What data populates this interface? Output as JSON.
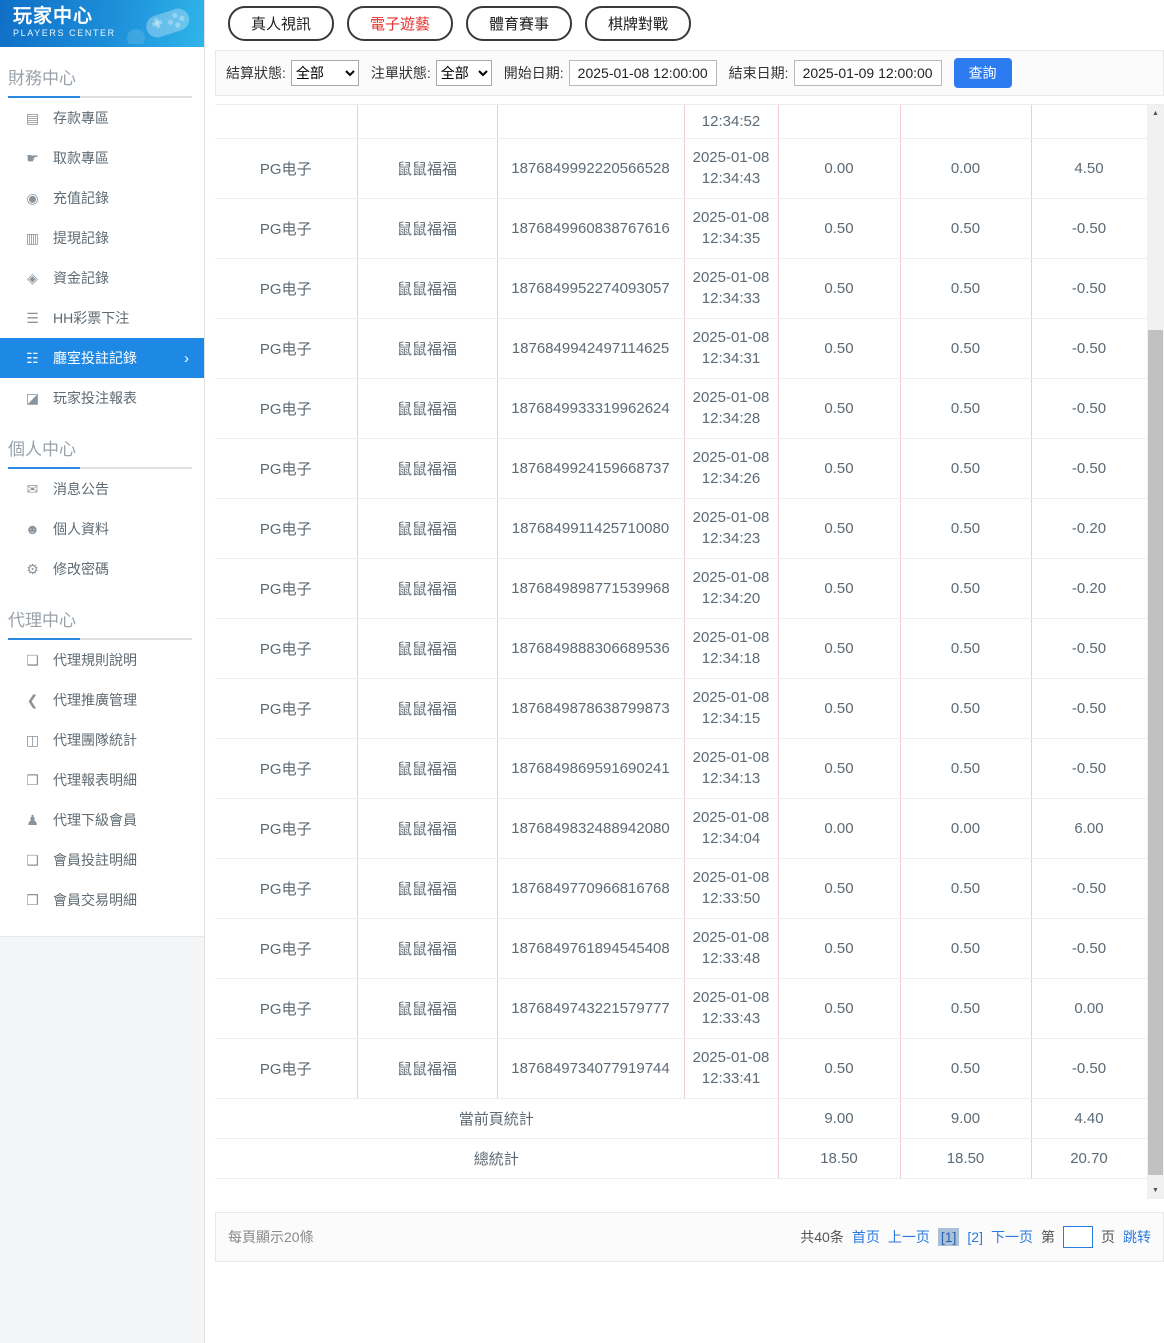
{
  "colors": {
    "brand_gradient_start": "#0f6fc6",
    "brand_gradient_end": "#2fb5ea",
    "active_menu_blue": "#1e88e5",
    "accent_link_blue": "#2a7ae2",
    "query_button_blue": "#2d7bf0",
    "active_tab_red": "#e63430",
    "table_vertical_border_pink": "#f3cdcd",
    "pagination_current_bg": "#a9c0d6"
  },
  "sidebar": {
    "brand": {
      "title": "玩家中心",
      "subtitle": "PLAYERS CENTER"
    },
    "sections": [
      {
        "title": "財務中心",
        "items": [
          {
            "label": "存款專區",
            "icon": "deposit-card-icon",
            "glyph": "▤"
          },
          {
            "label": "取款專區",
            "icon": "withdraw-hand-icon",
            "glyph": "☛"
          },
          {
            "label": "充值記錄",
            "icon": "recharge-record-icon",
            "glyph": "◉"
          },
          {
            "label": "提現記錄",
            "icon": "withdraw-record-icon",
            "glyph": "▥"
          },
          {
            "label": "資金記錄",
            "icon": "funds-record-icon",
            "glyph": "◈"
          },
          {
            "label": "HH彩票下注",
            "icon": "lottery-bet-icon",
            "glyph": "☰"
          },
          {
            "label": "廳室投註記錄",
            "icon": "room-bet-records-icon",
            "glyph": "☷",
            "active": true,
            "chevron": "›"
          },
          {
            "label": "玩家投注報表",
            "icon": "player-bet-report-icon",
            "glyph": "◪"
          }
        ]
      },
      {
        "title": "個人中心",
        "items": [
          {
            "label": "消息公告",
            "icon": "announcement-bell-icon",
            "glyph": "✉"
          },
          {
            "label": "個人資料",
            "icon": "profile-user-icon",
            "glyph": "☻"
          },
          {
            "label": "修改密碼",
            "icon": "change-password-gear-icon",
            "glyph": "⚙"
          }
        ]
      },
      {
        "title": "代理中心",
        "items": [
          {
            "label": "代理規則說明",
            "icon": "agent-rules-doc-icon",
            "glyph": "❏"
          },
          {
            "label": "代理推廣管理",
            "icon": "agent-promo-share-icon",
            "glyph": "❮"
          },
          {
            "label": "代理團隊統計",
            "icon": "agent-team-stats-icon",
            "glyph": "◫"
          },
          {
            "label": "代理報表明細",
            "icon": "agent-report-detail-icon",
            "glyph": "❐"
          },
          {
            "label": "代理下級會員",
            "icon": "agent-members-people-icon",
            "glyph": "♟"
          },
          {
            "label": "會員投註明細",
            "icon": "member-bet-detail-icon",
            "glyph": "❑"
          },
          {
            "label": "會員交易明細",
            "icon": "member-transaction-detail-icon",
            "glyph": "❒"
          }
        ]
      }
    ]
  },
  "tabs": [
    {
      "label": "真人視訊",
      "active": false
    },
    {
      "label": "電子遊藝",
      "active": true
    },
    {
      "label": "體育賽事",
      "active": false
    },
    {
      "label": "棋牌對戰",
      "active": false
    }
  ],
  "filters": {
    "settle_label": "結算狀態:",
    "settle_value": "全部",
    "order_label": "注單狀態:",
    "order_value": "全部",
    "start_label": "開始日期:",
    "start_value": "2025-01-08 12:00:00",
    "end_label": "結束日期:",
    "end_value": "2025-01-09 12:00:00",
    "search_label": "查詢"
  },
  "table": {
    "partial_row_time": "12:34:52",
    "rows": [
      {
        "hall": "PG电子",
        "game": "鼠鼠福福",
        "order_id": "1876849992220566528",
        "date": "2025-01-08",
        "time": "12:34:43",
        "bet": "0.00",
        "valid_bet": "0.00",
        "win_loss": "4.50"
      },
      {
        "hall": "PG电子",
        "game": "鼠鼠福福",
        "order_id": "1876849960838767616",
        "date": "2025-01-08",
        "time": "12:34:35",
        "bet": "0.50",
        "valid_bet": "0.50",
        "win_loss": "-0.50"
      },
      {
        "hall": "PG电子",
        "game": "鼠鼠福福",
        "order_id": "1876849952274093057",
        "date": "2025-01-08",
        "time": "12:34:33",
        "bet": "0.50",
        "valid_bet": "0.50",
        "win_loss": "-0.50"
      },
      {
        "hall": "PG电子",
        "game": "鼠鼠福福",
        "order_id": "1876849942497114625",
        "date": "2025-01-08",
        "time": "12:34:31",
        "bet": "0.50",
        "valid_bet": "0.50",
        "win_loss": "-0.50"
      },
      {
        "hall": "PG电子",
        "game": "鼠鼠福福",
        "order_id": "1876849933319962624",
        "date": "2025-01-08",
        "time": "12:34:28",
        "bet": "0.50",
        "valid_bet": "0.50",
        "win_loss": "-0.50"
      },
      {
        "hall": "PG电子",
        "game": "鼠鼠福福",
        "order_id": "1876849924159668737",
        "date": "2025-01-08",
        "time": "12:34:26",
        "bet": "0.50",
        "valid_bet": "0.50",
        "win_loss": "-0.50"
      },
      {
        "hall": "PG电子",
        "game": "鼠鼠福福",
        "order_id": "1876849911425710080",
        "date": "2025-01-08",
        "time": "12:34:23",
        "bet": "0.50",
        "valid_bet": "0.50",
        "win_loss": "-0.20"
      },
      {
        "hall": "PG电子",
        "game": "鼠鼠福福",
        "order_id": "1876849898771539968",
        "date": "2025-01-08",
        "time": "12:34:20",
        "bet": "0.50",
        "valid_bet": "0.50",
        "win_loss": "-0.20"
      },
      {
        "hall": "PG电子",
        "game": "鼠鼠福福",
        "order_id": "1876849888306689536",
        "date": "2025-01-08",
        "time": "12:34:18",
        "bet": "0.50",
        "valid_bet": "0.50",
        "win_loss": "-0.50"
      },
      {
        "hall": "PG电子",
        "game": "鼠鼠福福",
        "order_id": "1876849878638799873",
        "date": "2025-01-08",
        "time": "12:34:15",
        "bet": "0.50",
        "valid_bet": "0.50",
        "win_loss": "-0.50"
      },
      {
        "hall": "PG电子",
        "game": "鼠鼠福福",
        "order_id": "1876849869591690241",
        "date": "2025-01-08",
        "time": "12:34:13",
        "bet": "0.50",
        "valid_bet": "0.50",
        "win_loss": "-0.50"
      },
      {
        "hall": "PG电子",
        "game": "鼠鼠福福",
        "order_id": "1876849832488942080",
        "date": "2025-01-08",
        "time": "12:34:04",
        "bet": "0.00",
        "valid_bet": "0.00",
        "win_loss": "6.00"
      },
      {
        "hall": "PG电子",
        "game": "鼠鼠福福",
        "order_id": "1876849770966816768",
        "date": "2025-01-08",
        "time": "12:33:50",
        "bet": "0.50",
        "valid_bet": "0.50",
        "win_loss": "-0.50"
      },
      {
        "hall": "PG电子",
        "game": "鼠鼠福福",
        "order_id": "1876849761894545408",
        "date": "2025-01-08",
        "time": "12:33:48",
        "bet": "0.50",
        "valid_bet": "0.50",
        "win_loss": "-0.50"
      },
      {
        "hall": "PG电子",
        "game": "鼠鼠福福",
        "order_id": "1876849743221579777",
        "date": "2025-01-08",
        "time": "12:33:43",
        "bet": "0.50",
        "valid_bet": "0.50",
        "win_loss": "0.00"
      },
      {
        "hall": "PG电子",
        "game": "鼠鼠福福",
        "order_id": "1876849734077919744",
        "date": "2025-01-08",
        "time": "12:33:41",
        "bet": "0.50",
        "valid_bet": "0.50",
        "win_loss": "-0.50"
      }
    ],
    "page_summary": {
      "label": "當前頁統計",
      "bet": "9.00",
      "valid_bet": "9.00",
      "win_loss": "4.40"
    },
    "total_summary": {
      "label": "總統計",
      "bet": "18.50",
      "valid_bet": "18.50",
      "win_loss": "20.70"
    }
  },
  "pagination": {
    "page_size_text": "每頁顯示20條",
    "total_text": "共40条",
    "first": "首页",
    "prev": "上一页",
    "current_page": "[1]",
    "page2": "[2]",
    "next": "下一页",
    "jump_prefix": "第",
    "jump_suffix": "页",
    "jump_action": "跳转",
    "jump_value": ""
  }
}
